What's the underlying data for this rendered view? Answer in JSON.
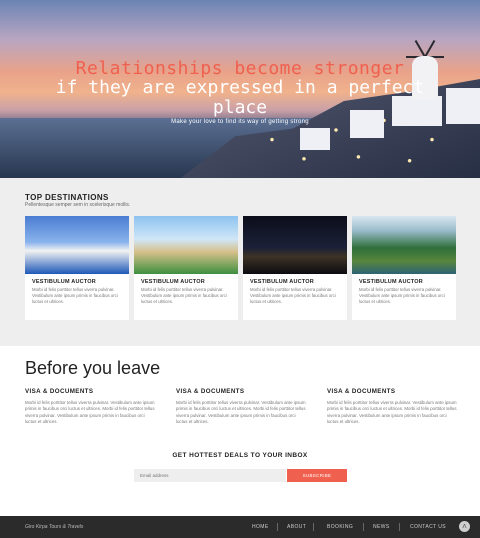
{
  "hero": {
    "line1": "Relationships become stronger",
    "line2": "if they are expressed in a perfect place",
    "subtitle": "Make your love to find its way of getting strong"
  },
  "destinations": {
    "title": "TOP DESTINATIONS",
    "subtitle": "Pellentesque semper sem in scelerisque mollis.",
    "cards": [
      {
        "title": "VESTIBULUM AUCTOR",
        "text": "Morbi id felis porttitor tellus viverra pulvinar. Vestibulum ante ipsum primis in faucibus orci luctus et ultrices."
      },
      {
        "title": "VESTIBULUM AUCTOR",
        "text": "Morbi id felis porttitor tellus viverra pulvinar. Vestibulum ante ipsum primis in faucibus orci luctus et ultrices."
      },
      {
        "title": "VESTIBULUM AUCTOR",
        "text": "Morbi id felis porttitor tellus viverra pulvinar. Vestibulum ante ipsum primis in faucibus orci luctus et ultrices."
      },
      {
        "title": "VESTIBULUM AUCTOR",
        "text": "Morbi id felis porttitor tellus viverra pulvinar. Vestibulum ante ipsum primis in faucibus orci luctus et ultrices."
      }
    ]
  },
  "before": {
    "title": "Before you leave",
    "columns": [
      {
        "heading": "VISA & DOCUMENTS",
        "text": "Morbi id felis porttitor tellus viverra pulvinar. Vestibulum ante ipsum primis in faucibus orci luctus et ultrices. Morbi id felis porttitor tellus viverra pulvinar. Vestibulum ante ipsum primis in faucibus orci luctus et ultrices."
      },
      {
        "heading": "VISA & DOCUMENTS",
        "text": "Morbi id felis porttitor tellus viverra pulvinar. Vestibulum ante ipsum primis in faucibus orci luctus et ultrices. Morbi id felis porttitor tellus viverra pulvinar. Vestibulum ante ipsum primis in faucibus orci luctus et ultrices."
      },
      {
        "heading": "VISA & DOCUMENTS",
        "text": "Morbi id felis porttitor tellus viverra pulvinar. Vestibulum ante ipsum primis in faucibus orci luctus et ultrices. Morbi id felis porttitor tellus viverra pulvinar. Vestibulum ante ipsum primis in faucibus orci luctus et ultrices."
      }
    ]
  },
  "newsletter": {
    "title": "GET HOTTEST DEALS TO YOUR INBOX",
    "placeholder": "Email address",
    "button": "SUBSCRIBE"
  },
  "footer": {
    "brand": "Giro Kirpa Tours & Travels",
    "nav": [
      "HOME",
      "ABOUT",
      "BOOKING",
      "NEWS",
      "CONTACT US"
    ],
    "scroll_top_icon": "chevron-up-icon"
  },
  "colors": {
    "accent": "#f0604f",
    "footer_bg": "#2b2b2b",
    "section_bg": "#eeeeee"
  }
}
